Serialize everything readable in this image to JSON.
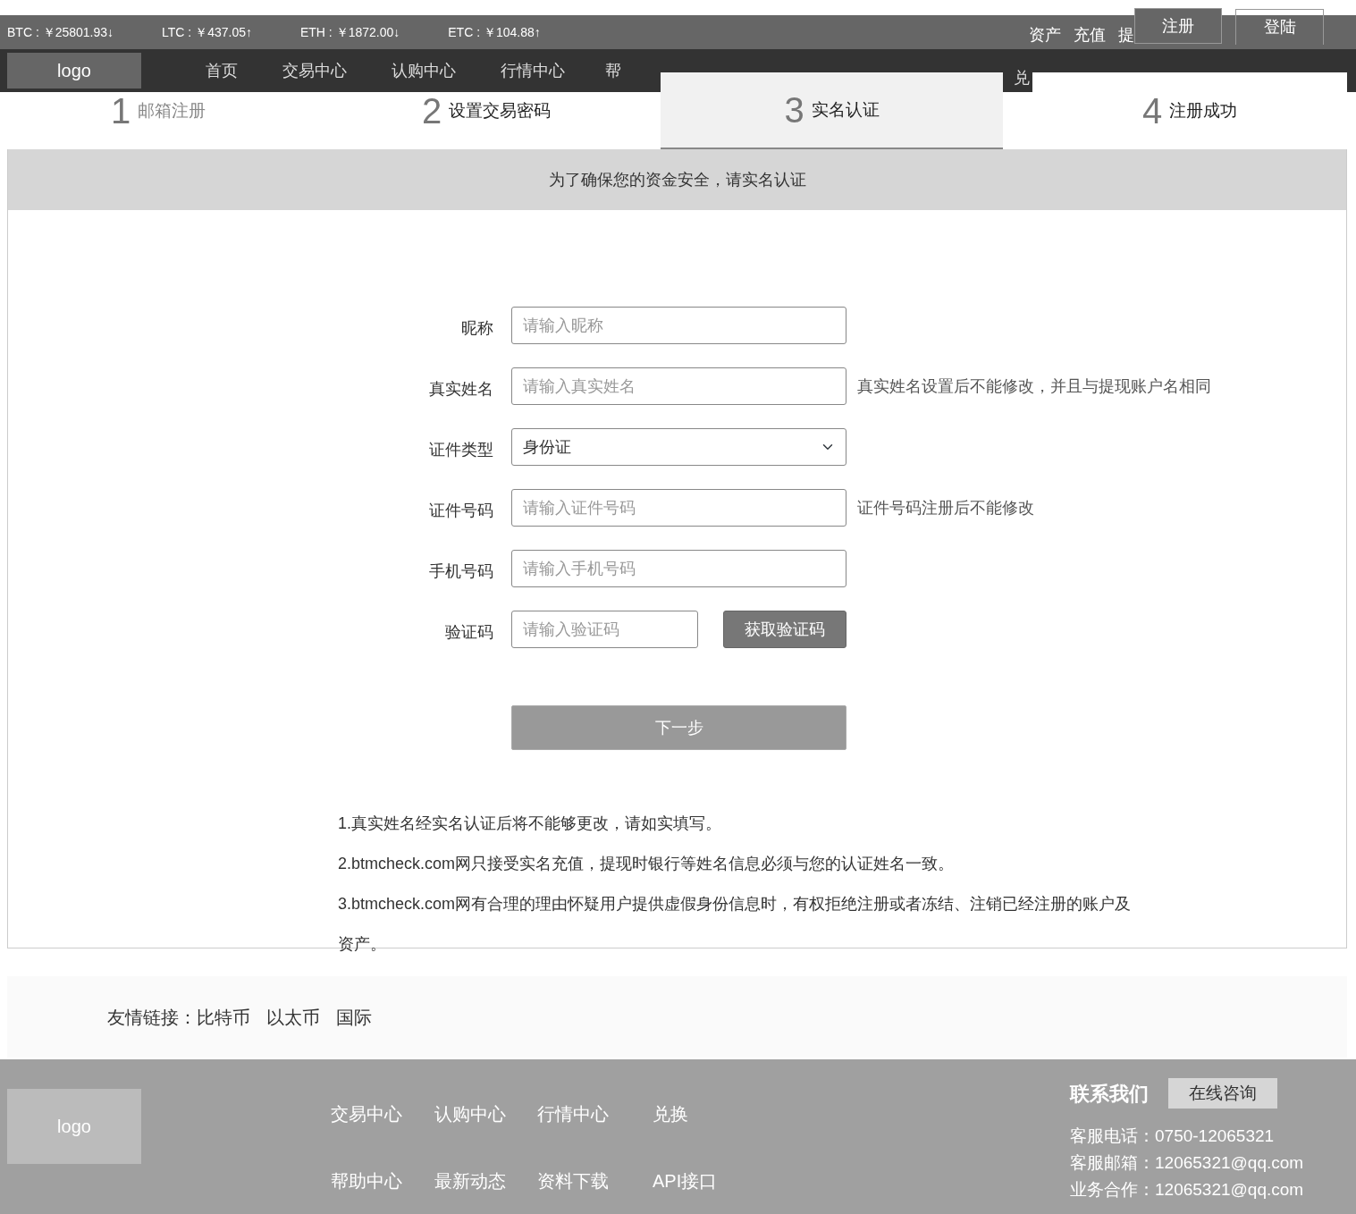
{
  "ticker": [
    {
      "text": "BTC : ￥25801.93↓"
    },
    {
      "text": "LTC : ￥437.05↑"
    },
    {
      "text": "ETH : ￥1872.00↓"
    },
    {
      "text": "ETC : ￥104.88↑"
    }
  ],
  "top_links": [
    "资产",
    "充值",
    "提"
  ],
  "auth_buttons": [
    {
      "label": "注册",
      "kind": "filled"
    },
    {
      "label": "登陆",
      "kind": "outline"
    }
  ],
  "nav": {
    "logo": "logo",
    "items": [
      "首页",
      "交易中心",
      "认购中心",
      "行情中心",
      "帮",
      "兑"
    ]
  },
  "steps": [
    {
      "number": "1",
      "label": "邮箱注册",
      "dimmed": true,
      "selected": false
    },
    {
      "number": "2",
      "label": "设置交易密码",
      "dimmed": false,
      "selected": false
    },
    {
      "number": "3",
      "label": "实名认证",
      "dimmed": false,
      "selected": true
    },
    {
      "number": "4",
      "label": "注册成功",
      "dimmed": false,
      "selected": false
    }
  ],
  "banner": "为了确保您的资金安全，请实名认证",
  "form": {
    "fields": [
      {
        "kind": "text",
        "label": "昵称",
        "placeholder": "请输入昵称"
      },
      {
        "kind": "text",
        "label": "真实姓名",
        "placeholder": "请输入真实姓名",
        "note": "真实姓名设置后不能修改，并且与提现账户名相同"
      },
      {
        "kind": "select",
        "label": "证件类型",
        "value": "身份证"
      },
      {
        "kind": "text",
        "label": "证件号码",
        "placeholder": "请输入证件号码",
        "note": "证件号码注册后不能修改"
      },
      {
        "kind": "text",
        "label": "手机号码",
        "placeholder": "请输入手机号码"
      },
      {
        "kind": "code",
        "label": "验证码",
        "placeholder": "请输入验证码",
        "button": "获取验证码"
      }
    ],
    "submit": "下一步"
  },
  "notes": [
    "1.真实姓名经实名认证后将不能够更改，请如实填写。",
    "2.btmcheck.com网只接受实名充值，提现时银行等姓名信息必须与您的认证姓名一致。",
    "3.btmcheck.com网有合理的理由怀疑用户提供虚假身份信息时，有权拒绝注册或者冻结、注销已经注册的账户及资产。"
  ],
  "friend_links": {
    "label": "友情链接：",
    "links": [
      "比特币",
      "以太币",
      "国际"
    ]
  },
  "footer": {
    "logo": "logo",
    "links": [
      [
        "交易中心",
        "认购中心",
        "行情中心",
        "兑换"
      ],
      [
        "帮助中心",
        "最新动态",
        "资料下载",
        "API接口"
      ]
    ],
    "contact_title": "联系我们",
    "consult_button": "在线咨询",
    "contact_lines": [
      "客服电话：0750-12065321",
      "客服邮箱：12065321@qq.com",
      "业务合作：12065321@qq.com"
    ]
  }
}
